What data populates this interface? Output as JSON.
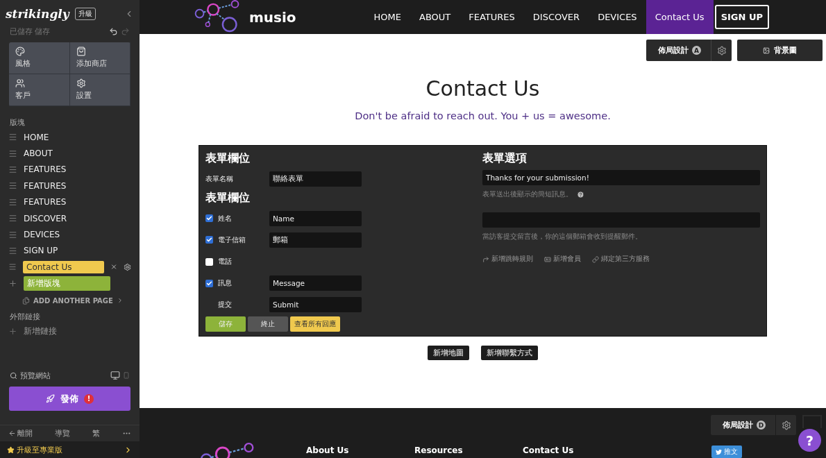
{
  "sidebar": {
    "logo": "strikingly",
    "upgrade_badge": "升級",
    "save_status": "已儲存 儲存",
    "tiles": [
      {
        "label": "風格",
        "kind": "style"
      },
      {
        "label": "添加商店",
        "kind": "store"
      },
      {
        "label": "客戶",
        "kind": "customers"
      },
      {
        "label": "設置",
        "kind": "settings"
      }
    ],
    "sections_title": "版塊",
    "sections": [
      {
        "label": "HOME",
        "selected": false
      },
      {
        "label": "ABOUT",
        "selected": false
      },
      {
        "label": "FEATURES",
        "selected": false
      },
      {
        "label": "FEATURES",
        "selected": false
      },
      {
        "label": "FEATURES",
        "selected": false
      },
      {
        "label": "DISCOVER",
        "selected": false
      },
      {
        "label": "DEVICES",
        "selected": false
      },
      {
        "label": "SIGN UP",
        "selected": false
      },
      {
        "label": "Contact Us",
        "selected": true
      }
    ],
    "add_section": "新增版塊",
    "add_page": "ADD ANOTHER PAGE",
    "external_links_title": "外部鏈接",
    "add_link": "新增鏈接",
    "preview": "預覽網站",
    "publish": "發佈",
    "publish_alert": "!",
    "bottom_nav": [
      "離開",
      "導覽",
      "繁"
    ],
    "upgrade_pro": "升級至專業版"
  },
  "site": {
    "brand": "musio",
    "nav": [
      {
        "label": "HOME",
        "selected": false
      },
      {
        "label": "ABOUT",
        "selected": false
      },
      {
        "label": "FEATURES",
        "selected": false
      },
      {
        "label": "DISCOVER",
        "selected": false
      },
      {
        "label": "DEVICES",
        "selected": false
      },
      {
        "label": "Contact Us",
        "selected": true
      }
    ],
    "signup": "SIGN UP",
    "toolbar": {
      "layout": "佈局設計",
      "layout_badge": "A",
      "background": "背景圖"
    },
    "heading": "Contact Us",
    "subtitle": "Don't be afraid to reach out. You + us = awesome.",
    "form_editor": {
      "left_title": "表單欄位",
      "name_label": "表單名稱",
      "name_value": "聯絡表單",
      "fields_title": "表單欄位",
      "fields": [
        {
          "kind": "checkbox",
          "label": "姓名",
          "checked": true,
          "value": "Name"
        },
        {
          "kind": "checkbox",
          "label": "電子信箱",
          "checked": true,
          "value": "郵箱"
        },
        {
          "kind": "checkbox",
          "label": "電話",
          "checked": false
        },
        {
          "kind": "checkbox",
          "label": "訊息",
          "checked": true,
          "value": "Message"
        },
        {
          "kind": "submit",
          "label": "提交",
          "value": "Submit"
        }
      ],
      "buttons": [
        {
          "label": "儲存",
          "kind": "save"
        },
        {
          "label": "終止",
          "kind": "cancel"
        },
        {
          "label": "查看所有回應",
          "kind": "responses"
        }
      ],
      "right_title": "表單選項",
      "message_value": "Thanks for your submission!",
      "message_hint": "表單送出後顯示的簡短訊息。",
      "email_hint": "當訪客提交留言後，你的這個郵箱會收到提醒郵件。",
      "links": [
        {
          "label": "新增跳轉規則",
          "kind": "redirect"
        },
        {
          "label": "新增會員",
          "kind": "member"
        },
        {
          "label": "綁定第三方服務",
          "kind": "link"
        }
      ]
    },
    "extra_buttons": [
      "新增地圖",
      "新增聯繫方式"
    ],
    "footer": {
      "layout": "佈局設計",
      "layout_badge": "D",
      "columns": [
        "About Us",
        "Resources",
        "Contact Us"
      ],
      "tweet": "推文",
      "help": "?"
    }
  }
}
